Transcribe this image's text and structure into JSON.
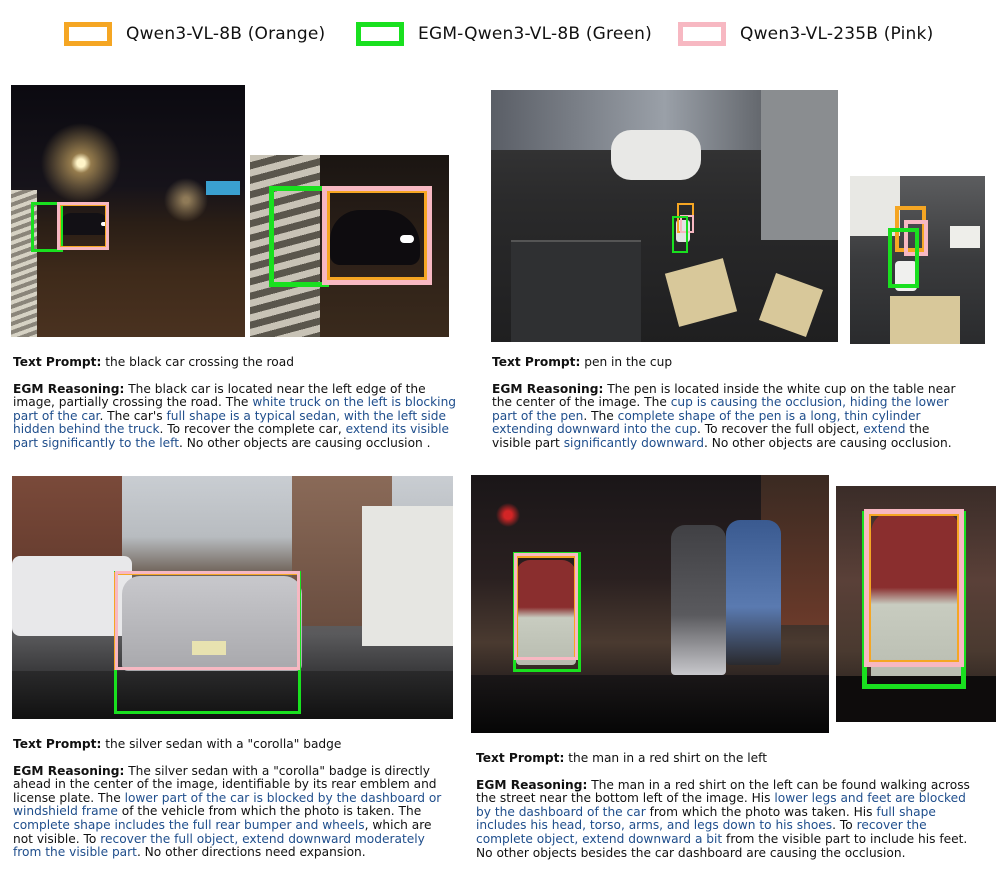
{
  "legend": [
    {
      "label": "Qwen3-VL-8B (Orange)",
      "color": "#f5a623"
    },
    {
      "label": "EGM-Qwen3-VL-8B (Green)",
      "color": "#19e01f"
    },
    {
      "label": "Qwen3-VL-235B (Pink)",
      "color": "#f7b8c2"
    }
  ],
  "colors": {
    "orange": "#f5a623",
    "green": "#19e01f",
    "pink": "#f7b8c2",
    "highlight": "#1f4e8c"
  },
  "examples": [
    {
      "prompt_label": "Text Prompt:",
      "prompt": "the black car crossing the road",
      "reasoning_label": "EGM Reasoning:",
      "reasoning": [
        {
          "t": "The black car is located near the left edge of the image, partially crossing the road. The "
        },
        {
          "t": "white truck on the left is blocking part of the car",
          "hl": true
        },
        {
          "t": ". The car's "
        },
        {
          "t": "full shape is a typical sedan, with the left side hidden behind the truck",
          "hl": true
        },
        {
          "t": ". To recover the complete car, "
        },
        {
          "t": "extend its visible part significantly to the left",
          "hl": true
        },
        {
          "t": ". No other objects are causing occlusion ."
        }
      ]
    },
    {
      "prompt_label": "Text Prompt:",
      "prompt": "pen in the cup",
      "reasoning_label": "EGM Reasoning:",
      "reasoning": [
        {
          "t": "The pen is located inside the white cup on the table near the center of the image. The "
        },
        {
          "t": "cup is causing the occlusion, hiding the lower part of the pen",
          "hl": true
        },
        {
          "t": ". The "
        },
        {
          "t": "complete shape of the pen is a long, thin cylinder extending downward into the cup",
          "hl": true
        },
        {
          "t": ". To recover the full object, "
        },
        {
          "t": "extend",
          "hl": true
        },
        {
          "t": " the visible part "
        },
        {
          "t": "significantly downward",
          "hl": true
        },
        {
          "t": ". No other objects are causing occlusion."
        }
      ]
    },
    {
      "prompt_label": "Text Prompt:",
      "prompt": "the silver sedan with a \"corolla\" badge",
      "reasoning_label": "EGM Reasoning:",
      "reasoning": [
        {
          "t": "The silver sedan with a \"corolla\" badge is directly ahead in the center of the image, identifiable by its rear emblem and license plate. The "
        },
        {
          "t": "lower part of the car is blocked by the dashboard or windshield frame",
          "hl": true
        },
        {
          "t": " of the vehicle from which the photo is taken. The "
        },
        {
          "t": "complete shape includes the full rear bumper and wheels",
          "hl": true
        },
        {
          "t": ", which are not visible. To "
        },
        {
          "t": "recover the full object, extend downward moderately from the visible part",
          "hl": true
        },
        {
          "t": ". No other directions need expansion."
        }
      ]
    },
    {
      "prompt_label": "Text Prompt:",
      "prompt": "the man in a red shirt on the left",
      "reasoning_label": "EGM Reasoning:",
      "reasoning": [
        {
          "t": "The man in a red shirt on the left can be found walking across the street near the bottom left of the image. His "
        },
        {
          "t": "lower legs and feet are blocked by the dashboard of the car",
          "hl": true
        },
        {
          "t": " from which the photo was taken. His "
        },
        {
          "t": "full shape includes his head, torso, arms, and legs down to his shoes",
          "hl": true
        },
        {
          "t": ". To "
        },
        {
          "t": "recover the complete object, extend downward a bit",
          "hl": true
        },
        {
          "t": " from the visible part to include his feet. No other objects besides the car dashboard are causing the occlusion."
        }
      ]
    }
  ]
}
